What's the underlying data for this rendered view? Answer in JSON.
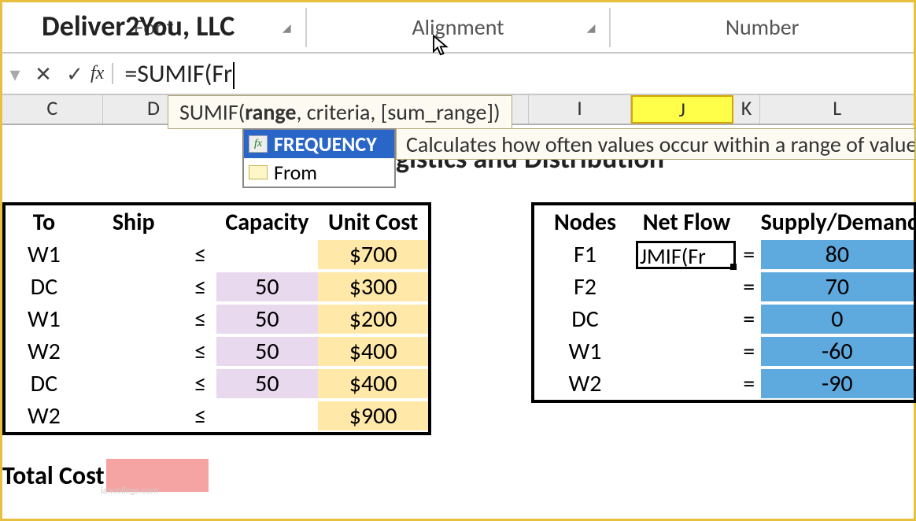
{
  "ribbon": {
    "font": "Font",
    "alignment": "Alignment",
    "number": "Number"
  },
  "formula_bar": {
    "cancel": "✕",
    "enter": "✓",
    "fx": "fx",
    "value": "=SUMIF(Fr"
  },
  "columns": {
    "C": "C",
    "D": "D",
    "I": "I",
    "J": "J",
    "K": "K",
    "L": "L"
  },
  "tooltip": {
    "func_name": "SUMIF",
    "open": "(",
    "arg1": "range",
    "rest": ", criteria, [sum_range])"
  },
  "title": "Deliver2You, LLC",
  "title_rest": "gistics and Distribution",
  "autocomplete": {
    "opt1": "FREQUENCY",
    "opt2": "From",
    "desc": "Calculates how often values occur within a range of values an"
  },
  "left_table": {
    "headers": {
      "to": "To",
      "ship": "Ship",
      "cap": "Capacity",
      "cost": "Unit Cost"
    },
    "le": "≤",
    "rows": [
      {
        "to": "W1",
        "cap": "",
        "cost": "$700"
      },
      {
        "to": "DC",
        "cap": "50",
        "cost": "$300"
      },
      {
        "to": "W1",
        "cap": "50",
        "cost": "$200"
      },
      {
        "to": "W2",
        "cap": "50",
        "cost": "$400"
      },
      {
        "to": "DC",
        "cap": "50",
        "cost": "$400"
      },
      {
        "to": "W2",
        "cap": "",
        "cost": "$900"
      }
    ]
  },
  "right_table": {
    "headers": {
      "nodes": "Nodes",
      "netflow": "Net Flow",
      "sd": "Supply/Demand"
    },
    "eq": "=",
    "editing": "JMIF(Fr",
    "rows": [
      {
        "node": "F1",
        "sd": "80"
      },
      {
        "node": "F2",
        "sd": "70"
      },
      {
        "node": "DC",
        "sd": "0"
      },
      {
        "node": "W1",
        "sd": "-60"
      },
      {
        "node": "W2",
        "sd": "-90"
      }
    ]
  },
  "totalcost_label": "Total Cost",
  "watermark": "iancollege.com"
}
